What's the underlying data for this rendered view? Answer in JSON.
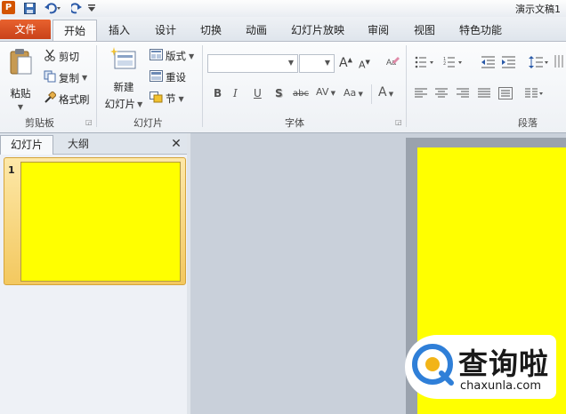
{
  "window": {
    "doc_title": "演示文稿1",
    "logo_letter": "P"
  },
  "tabs": {
    "file": "文件",
    "home": "开始",
    "insert": "插入",
    "design": "设计",
    "transitions": "切换",
    "animations": "动画",
    "slideshow": "幻灯片放映",
    "review": "审阅",
    "view": "视图",
    "special": "特色功能"
  },
  "clipboard": {
    "paste": "粘贴",
    "cut": "剪切",
    "copy": "复制",
    "format_painter": "格式刷",
    "label": "剪贴板"
  },
  "slides_group": {
    "new_slide_line1": "新建",
    "new_slide_line2": "幻灯片",
    "layout": "版式",
    "reset": "重设",
    "section": "节",
    "label": "幻灯片"
  },
  "font_group": {
    "label": "字体",
    "bold": "B",
    "italic": "I",
    "underline": "U",
    "shadow": "S",
    "strike": "abc",
    "spacing": "AV",
    "case": "Aa",
    "grow": "A",
    "shrink": "A",
    "color": "A"
  },
  "paragraph_group": {
    "label": "段落"
  },
  "panel": {
    "tab_slides": "幻灯片",
    "tab_outline": "大纲",
    "close": "✕",
    "slide_number": "1"
  },
  "watermark": {
    "logo_char": "Q",
    "text": "查询啦",
    "url": "chaxunla.com"
  },
  "colors": {
    "slide_fill": "#ffff00",
    "file_tab": "#d9501f",
    "watermark_blue": "#2f7fd8"
  }
}
